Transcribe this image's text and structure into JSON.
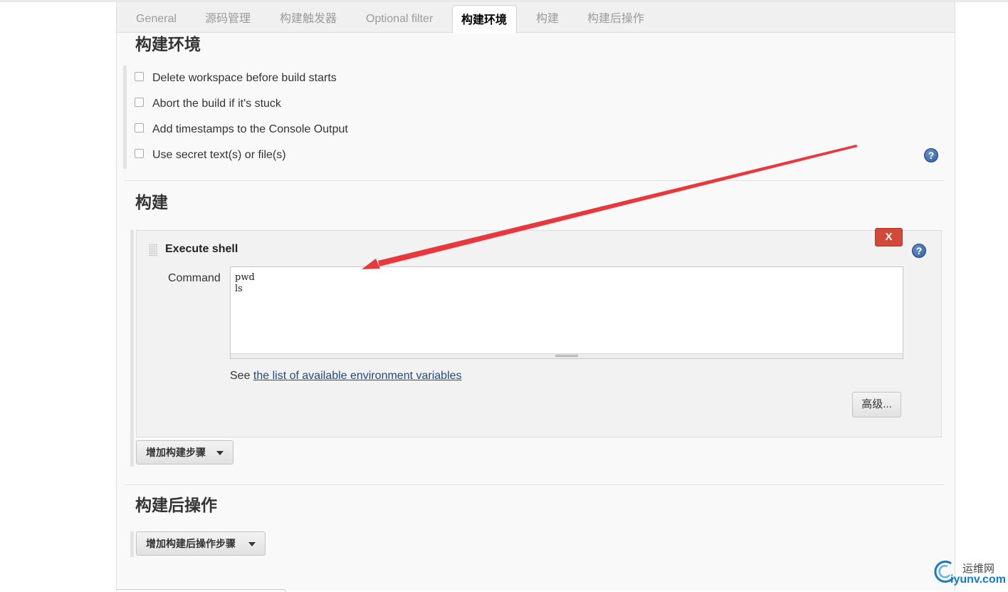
{
  "tabs": [
    {
      "label": "General"
    },
    {
      "label": "源码管理"
    },
    {
      "label": "构建触发器"
    },
    {
      "label": "Optional filter"
    },
    {
      "label": "构建环境",
      "active": true
    },
    {
      "label": "构建"
    },
    {
      "label": "构建后操作"
    }
  ],
  "build_env": {
    "title": "构建环境",
    "options": [
      {
        "label": "Delete workspace before build starts",
        "checked": false
      },
      {
        "label": "Abort the build if it's stuck",
        "checked": false
      },
      {
        "label": "Add timestamps to the Console Output",
        "checked": false
      },
      {
        "label": "Use secret text(s) or file(s)",
        "checked": false
      }
    ],
    "help_icon": "question-icon"
  },
  "build": {
    "title": "构建",
    "step": {
      "title": "Execute shell",
      "delete_label": "X",
      "command_label": "Command",
      "command_value": "pwd\nls",
      "see_prefix": "See ",
      "see_link": "the list of available environment variables",
      "advanced_label": "高级...",
      "help_icon": "question-icon"
    },
    "add_step_label": "增加构建步骤"
  },
  "post_build": {
    "title": "构建后操作",
    "add_step_label": "增加构建后操作步骤"
  },
  "watermark": {
    "cn": "运维网",
    "en": "iyunv.com"
  },
  "colors": {
    "accent_link": "#204a87",
    "delete_red": "#d24939",
    "annotation_arrow": "#e8383d",
    "watermark_blue": "#0e7cc7"
  }
}
